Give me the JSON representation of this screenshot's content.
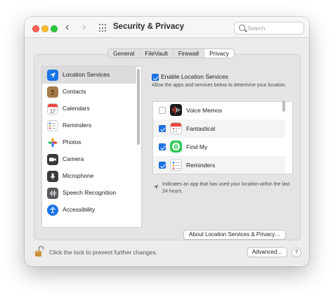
{
  "window": {
    "title": "Security & Privacy"
  },
  "toolbar": {
    "back_glyph": "‹",
    "forward_glyph": "›",
    "grid_icon": "grid-icon"
  },
  "search": {
    "placeholder": "Search",
    "value": ""
  },
  "tabs": [
    {
      "label": "General",
      "active": false
    },
    {
      "label": "FileVault",
      "active": false
    },
    {
      "label": "Firewall",
      "active": false
    },
    {
      "label": "Privacy",
      "active": true
    }
  ],
  "sidebar": {
    "items": [
      {
        "label": "Location Services",
        "icon": "location-arrow-icon",
        "color": "#1a73e8",
        "selected": true
      },
      {
        "label": "Contacts",
        "icon": "contacts-book-icon",
        "color": "#a47a4a",
        "selected": false
      },
      {
        "label": "Calendars",
        "icon": "calendar-icon",
        "color": "#ffffff",
        "selected": false
      },
      {
        "label": "Reminders",
        "icon": "reminders-list-icon",
        "color": "#ffffff",
        "selected": false
      },
      {
        "label": "Photos",
        "icon": "photos-flower-icon",
        "color": "#ffffff",
        "selected": false
      },
      {
        "label": "Camera",
        "icon": "camera-icon",
        "color": "#3a3a3c",
        "selected": false
      },
      {
        "label": "Microphone",
        "icon": "microphone-icon",
        "color": "#3a3a3c",
        "selected": false
      },
      {
        "label": "Speech Recognition",
        "icon": "waveform-icon",
        "color": "#5a5a5e",
        "selected": false
      },
      {
        "label": "Accessibility",
        "icon": "accessibility-icon",
        "color": "#1a73e8",
        "selected": false
      }
    ]
  },
  "location": {
    "enable_label": "Enable Location Services",
    "enable_checked": true,
    "description": "Allow the apps and services below to determine your location.",
    "apps": [
      {
        "label": "Voice Memos",
        "checked": false,
        "icon": "voice-memos-icon"
      },
      {
        "label": "Fantastical",
        "checked": true,
        "icon": "fantastical-calendar-icon"
      },
      {
        "label": "Find My",
        "checked": true,
        "icon": "find-my-icon"
      },
      {
        "label": "Reminders",
        "checked": true,
        "icon": "reminders-icon"
      }
    ],
    "note": "Indicates an app that has used your location within the last 24 hours.",
    "about_button": "About Location Services & Privacy…"
  },
  "footer": {
    "lock_text": "Click the lock to prevent further changes.",
    "advanced_button": "Advanced…",
    "help_button": "?"
  },
  "colors": {
    "accent": "#1a73e8",
    "selection": "#dcdcdc"
  }
}
